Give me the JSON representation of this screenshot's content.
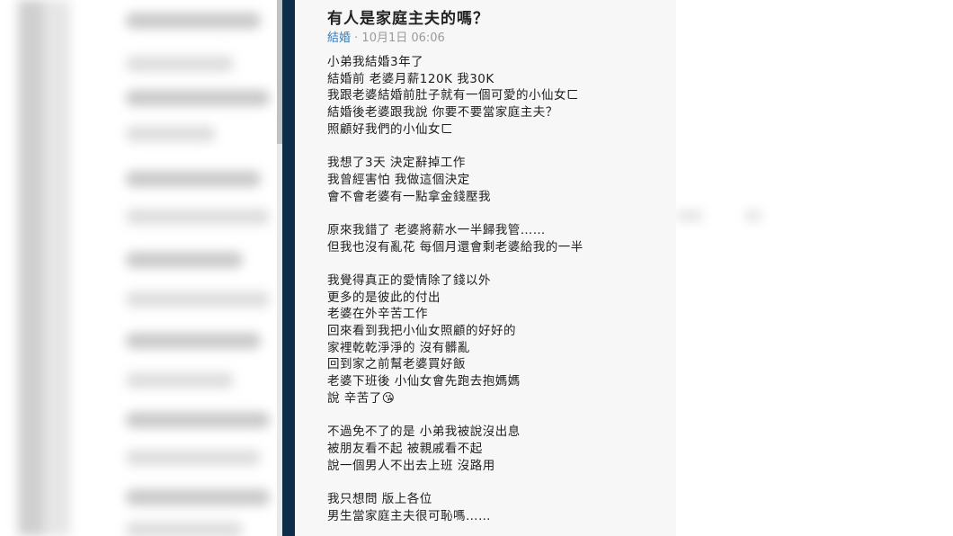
{
  "post": {
    "title": "有人是家庭主夫的嗎？",
    "board": "結婚",
    "separator": " · ",
    "timestamp": "10月1日 06:06",
    "paragraphs": [
      [
        "小弟我結婚3年了",
        "結婚前 老婆月薪120K 我30K",
        "我跟老婆結婚前肚子就有一個可愛的小仙女ㄈ",
        "結婚後老婆跟我說 你要不要當家庭主夫？",
        "照顧好我們的小仙女ㄈ"
      ],
      [
        "我想了3天 決定辭掉工作",
        "我曾經害怕 我做這個決定",
        "會不會老婆有一點拿金錢壓我"
      ],
      [
        "原來我錯了 老婆將薪水一半歸我管……",
        "但我也沒有亂花 每個月還會剩老婆給我的一半"
      ],
      [
        "我覺得真正的愛情除了錢以外",
        "更多的是彼此的付出",
        "老婆在外辛苦工作",
        "回來看到我把小仙女照顧的好好的",
        "家裡乾乾淨淨的 沒有髒亂",
        "回到家之前幫老婆買好飯",
        "老婆下班後 小仙女會先跑去抱媽媽",
        "說 辛苦了😘"
      ],
      [
        "不過免不了的是 小弟我被說沒出息",
        "被朋友看不起 被親戚看不起",
        "說一個男人不出去上班 沒路用"
      ],
      [
        "我只想問 版上各位",
        "男生當家庭主夫很可恥嗎……"
      ]
    ]
  },
  "colors": {
    "navy_bar": "#0d2d49",
    "panel_bg": "#f7f7f7",
    "board_link": "#3a7bb8",
    "meta_text": "#9a9a9a"
  }
}
